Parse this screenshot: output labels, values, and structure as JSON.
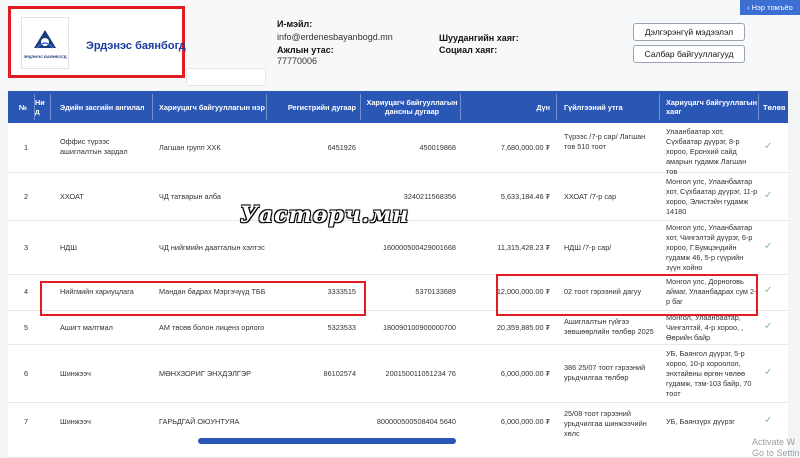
{
  "header": {
    "company_name": "Эрдэнэс баянбогд",
    "logo_subtext": "ЭРДЭНЭС БАЯНБОГД",
    "email_label": "И-мэйл:",
    "email_value": "info@erdenesbayanbogd.mn",
    "phone_label": "Ажлын утас:",
    "phone_value": "77770006",
    "complaint_label": "Шуудангийн хаяг:",
    "social_label": "Социал хаяг:",
    "btn_detail": "Дэлгэрэнгүй мэдээлэл",
    "btn_branch": "Салбар байгууллагууд",
    "top_tab": "Нэр томъёо"
  },
  "table": {
    "headers": {
      "no": "№",
      "id": "Ни д",
      "category": "Эдийн засгийн ангилал",
      "recipient": "Хариуцагч байгууллагын нэр",
      "reg_no": "Регистрийн дугаар",
      "account": "Хариуцагч байгууллагын дансны дугаар",
      "amount": "Дүн",
      "purpose": "Гүйлгээний утга",
      "address": "Хариуцагч байгууллагын хаяг",
      "paid": "Төлөв"
    },
    "rows": [
      {
        "no": "1",
        "category": "Оффис түрээс ашиглалтын зардал",
        "recipient": "Лагшан групп ХХК",
        "reg": "6451926",
        "account": "450019868",
        "amount": "7,680,000.00 ₮",
        "purpose": "Түрээс /7-р сар/ Лагшан тов 510 тоот",
        "address": "Улаанбаатар хот, Сүхбаатар дүүрэг, 8-р хороо, Еронхий сайд амарын гудамж Лагшан тов"
      },
      {
        "no": "2",
        "category": "ХХОАТ",
        "recipient": "ЧД татварын алба",
        "reg": "",
        "account": "3240211568356",
        "amount": "5,633,184.46 ₮",
        "purpose": "ХХОАТ /7-р сар",
        "address": "Монгол улс, Улаанбаатар хот, Сүхбаатар дүүрэг, 11-р хороо, Элистэйн гудамж 14180"
      },
      {
        "no": "3",
        "category": "НДШ",
        "recipient": "ЧД нийгмийн даатгалын хэлтэс",
        "reg": "",
        "account": "160000500429001668",
        "amount": "11,315,428.23 ₮",
        "purpose": "НДШ /7-р сар/",
        "address": "Монгол улс, Улаанбаатар хот, Чингэлтэй дүүрэг, 6-р хороо, Г.Бумцэндийн гудамж 46, 5-р гүүрийн зүүн хойно"
      },
      {
        "no": "4",
        "category": "Нийгмийн хариуцлага",
        "recipient": "Мандан бадрах Мэргэчүүд ТББ",
        "reg": "3333515",
        "account": "5370133689",
        "amount": "12,000,000.00 ₮",
        "purpose": "02 тоот гэрээний дагуу",
        "address": "Монгол улс, Дорноговь аймаг, Улаанбадрах сум 2-р баг"
      },
      {
        "no": "5",
        "category": "Ашигт малтмал",
        "recipient": "АМ төсөв болон лиценз орлого",
        "reg": "5323533",
        "account": "180090100900000700",
        "amount": "20,359,885.00 ₮",
        "purpose": "Ашиглалтын гүйгээ зөвшөөрлийн төлбөр 2025",
        "address": "Монгол, Улаанбаатар, Чингэлтэй, 4-р хороо, , Өөрийн байр"
      },
      {
        "no": "6",
        "category": "Шинжээч",
        "recipient": "МӨНХЗОРИГ ЭНХДЭЛГЭР",
        "reg": "86102574",
        "account": "200150011051234 76",
        "amount": "6,000,000.00 ₮",
        "purpose": "386 25/07 тоот гэрээний урьдчилгаа төлбөр",
        "address": "УБ, Баянгол дүүрэг, 5-р хороо, 10-р хороолол, энхтайвны өргөн чөлөө гудамж, тэм-103 байр, 70 тоот"
      },
      {
        "no": "7",
        "category": "Шинжээч",
        "recipient": "ГАРЬДГАЙ ОЮУНТУЯА",
        "reg": "",
        "account": "800000500508404 5640",
        "amount": "6,000,000.00 ₮",
        "purpose": "25/08 тоот гэрээний урьдчилгаа шинжээчийн хөлс",
        "address": "УБ, Баянзүрх дүүрэг"
      }
    ]
  },
  "watermark": "Уастөрч.мн",
  "os_notice": {
    "line1": "Activate W",
    "line2": "Go to Settin"
  },
  "colors": {
    "header_blue": "#2a57b6",
    "highlight_red": "#e31b23",
    "check_green": "#7cc576"
  }
}
